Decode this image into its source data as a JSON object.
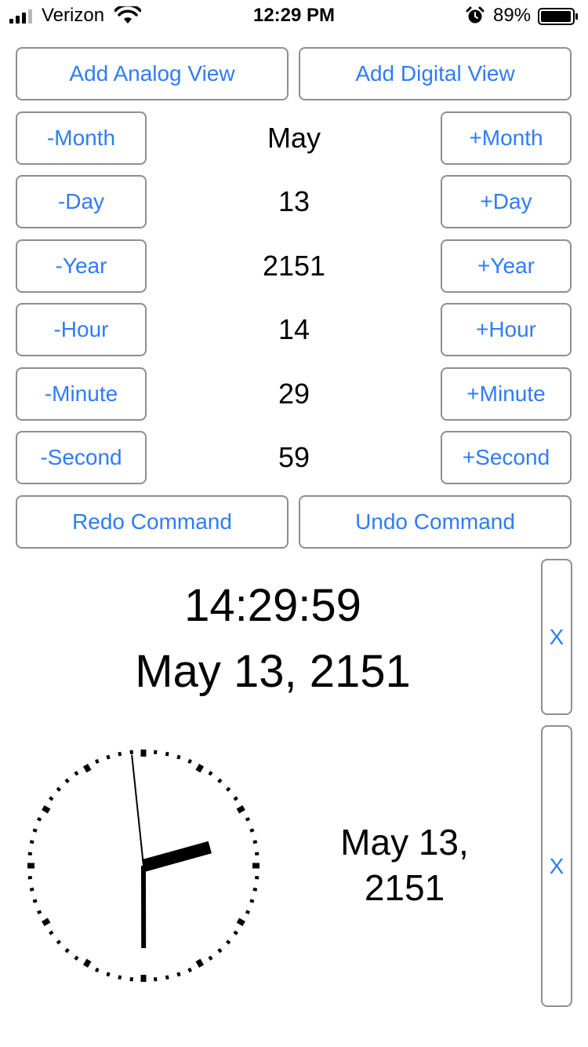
{
  "status_bar": {
    "carrier": "Verizon",
    "time": "12:29 PM",
    "battery_percent": "89%"
  },
  "toolbar": {
    "add_analog_label": "Add Analog View",
    "add_digital_label": "Add Digital View"
  },
  "controls": [
    {
      "minus": "-Month",
      "value": "May",
      "plus": "+Month"
    },
    {
      "minus": "-Day",
      "value": "13",
      "plus": "+Day"
    },
    {
      "minus": "-Year",
      "value": "2151",
      "plus": "+Year"
    },
    {
      "minus": "-Hour",
      "value": "14",
      "plus": "+Hour"
    },
    {
      "minus": "-Minute",
      "value": "29",
      "plus": "+Minute"
    },
    {
      "minus": "-Second",
      "value": "59",
      "plus": "+Second"
    }
  ],
  "commands": {
    "redo_label": "Redo Command",
    "undo_label": "Undo Command"
  },
  "digital_view": {
    "time": "14:29:59",
    "date": "May 13, 2151",
    "close_label": "X"
  },
  "analog_view": {
    "hour": 14,
    "minute": 29,
    "second": 59,
    "date_line1": "May 13,",
    "date_line2": "2151",
    "close_label": "X"
  },
  "colors": {
    "accent": "#2f7cf6",
    "border": "#8e8e93"
  }
}
